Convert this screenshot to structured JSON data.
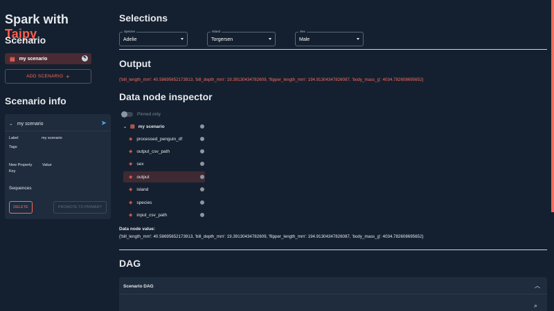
{
  "app": {
    "title_prefix": "Spark with ",
    "title_accent": "Taipy"
  },
  "sidebar": {
    "scenario_heading": "Scenario",
    "scenario_item": "my scenario",
    "add_scenario_label": "ADD SCENARIO",
    "info_heading": "Scenario info",
    "info": {
      "header": "my scenario",
      "label_key": "Label",
      "label_value": "my scenario",
      "tags_key": "Tags",
      "new_property_key": "New Property",
      "new_property_key2": "Key",
      "value_key": "Value",
      "sequences": "Sequences",
      "delete": "DELETE",
      "promote": "PROMOTE TO PRIMARY"
    }
  },
  "main": {
    "selections_heading": "Selections",
    "selects": [
      {
        "caption": "Species",
        "value": "Adelie"
      },
      {
        "caption": "Island",
        "value": "Torgersen"
      },
      {
        "caption": "Sex",
        "value": "Male"
      }
    ],
    "output_heading": "Output",
    "output_text": "{'bill_length_mm': 40.58695652173913, 'bill_depth_mm': 19.39130434782609, 'flipper_length_mm': 194.91304347826087, 'body_mass_g': 4034.782608695652}",
    "inspector_heading": "Data node inspector",
    "pinned_only": "Pinned only",
    "tree_root": "my scenario",
    "nodes": [
      {
        "label": "processed_penguin_df",
        "selected": false
      },
      {
        "label": "output_csv_path",
        "selected": false
      },
      {
        "label": "sex",
        "selected": false
      },
      {
        "label": "output",
        "selected": true
      },
      {
        "label": "island",
        "selected": false
      },
      {
        "label": "species",
        "selected": false
      },
      {
        "label": "input_csv_path",
        "selected": false
      }
    ],
    "data_node_value_label": "Data node value:",
    "data_node_value": "{'bill_length_mm': 40.58695652173913, 'bill_depth_mm': 19.39130434782609, 'flipper_length_mm': 194.91304347826087, 'body_mass_g': 4034.782608695652}",
    "dag_heading": "DAG",
    "dag_card_title": "Scenario DAG"
  },
  "colors": {
    "accent": "#ff6b5b",
    "background": "#14202f",
    "card": "#1e2c3d"
  }
}
